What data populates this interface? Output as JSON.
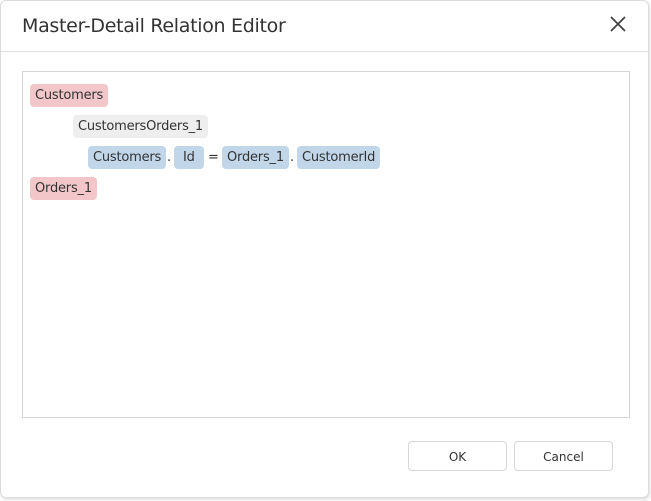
{
  "dialog": {
    "title": "Master-Detail Relation Editor",
    "close_icon": "close-icon"
  },
  "editor": {
    "master_table": "Customers",
    "relation_name": "CustomersOrders_1",
    "condition": {
      "left_table": "Customers",
      "dot1": ".",
      "left_field": "Id",
      "operator": "=",
      "right_table": "Orders_1",
      "dot2": ".",
      "right_field": "CustomerId"
    },
    "detail_table": "Orders_1"
  },
  "buttons": {
    "ok": "OK",
    "cancel": "Cancel"
  },
  "colors": {
    "table_chip": "#f3c7c9",
    "relation_chip": "#eeeeee",
    "field_chip": "#c2d6ea"
  }
}
